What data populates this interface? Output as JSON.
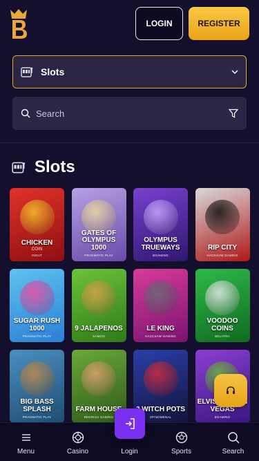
{
  "header": {
    "login_label": "LOGIN",
    "register_label": "REGISTER"
  },
  "category": {
    "selected": "Slots"
  },
  "search": {
    "placeholder": "Search"
  },
  "section": {
    "title": "Slots"
  },
  "games": [
    {
      "name": "CHICKEN",
      "sub": "COIN",
      "provider": "INOUT",
      "bg1": "#e0322a",
      "bg2": "#8e0f12",
      "art": "#f7c22a"
    },
    {
      "name": "GATES OF OLYMPUS 1000",
      "sub": "",
      "provider": "PRAGMATIC PLAY",
      "bg1": "#b6a0e6",
      "bg2": "#6a4aa8",
      "art": "#f0d9a0"
    },
    {
      "name": "OLYMPUS TRUEWAYS",
      "sub": "",
      "provider": "BGAMING",
      "bg1": "#7a3fd0",
      "bg2": "#2f1770",
      "art": "#c9a8ff"
    },
    {
      "name": "RIP CITY",
      "sub": "",
      "provider": "HACKSAW GAMING",
      "bg1": "#d8d8d8",
      "bg2": "#b01818",
      "art": "#111111"
    },
    {
      "name": "SUGAR RUSH 1000",
      "sub": "",
      "provider": "PRAGMATIC PLAY",
      "bg1": "#5fc2f0",
      "bg2": "#2a7fd6",
      "art": "#f04aa8"
    },
    {
      "name": "9 JALAPENOS",
      "sub": "",
      "provider": "GAMZIX",
      "bg1": "#6cc23a",
      "bg2": "#2f7a18",
      "art": "#d9a14a"
    },
    {
      "name": "LE KING",
      "sub": "",
      "provider": "HACKSAW GAMING",
      "bg1": "#d83a9a",
      "bg2": "#7a1470",
      "art": "#6a6a7a"
    },
    {
      "name": "VOODOO COINS",
      "sub": "",
      "provider": "BELATRA",
      "bg1": "#2fb94a",
      "bg2": "#0f6a20",
      "art": "#e8e8e8"
    },
    {
      "name": "BIG BASS SPLASH",
      "sub": "",
      "provider": "PRAGMATIC PLAY",
      "bg1": "#4a8fc0",
      "bg2": "#1f4d72",
      "art": "#c08a4a"
    },
    {
      "name": "FARM HOUSE",
      "sub": "",
      "provider": "REDRICH GAMING",
      "bg1": "#6aa83a",
      "bg2": "#2f5a18",
      "art": "#e0a070"
    },
    {
      "name": "3 WITCH POTS",
      "sub": "",
      "provider": "SPINOMENAL",
      "bg1": "#2a3fa8",
      "bg2": "#12143a",
      "art": "#d02a3a"
    },
    {
      "name": "ELVIS FROG IN VEGAS",
      "sub": "",
      "provider": "BGAMING",
      "bg1": "#8a3fd0",
      "bg2": "#3a1680",
      "art": "#6ab83a"
    }
  ],
  "bottom_nav": {
    "menu": "Menu",
    "casino": "Casino",
    "login": "Login",
    "sports": "Sports",
    "search": "Search"
  }
}
